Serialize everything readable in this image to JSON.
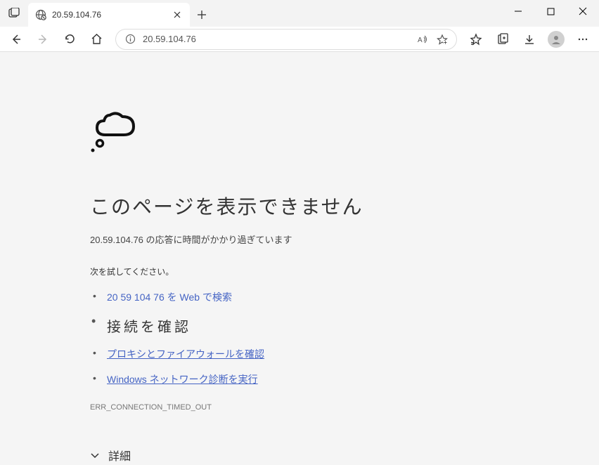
{
  "tab": {
    "title": "20.59.104.76"
  },
  "address": {
    "url": "20.59.104.76"
  },
  "error": {
    "title": "このページを表示できません",
    "subtitle": "20.59.104.76 の応答に時間がかかり過ぎています",
    "try_label": "次を試してください。",
    "suggestions": {
      "search": "20 59 104 76 を Web で検索",
      "check_connection": "接続を確認",
      "proxy_firewall": "プロキシとファイアウォールを確認",
      "network_diag": "Windows ネットワーク診断を実行"
    },
    "code": "ERR_CONNECTION_TIMED_OUT",
    "details_label": "詳細"
  }
}
